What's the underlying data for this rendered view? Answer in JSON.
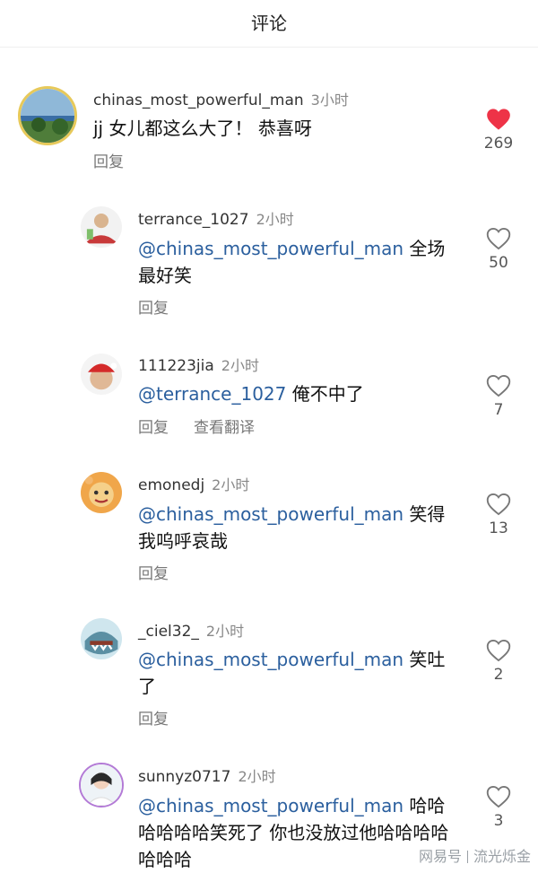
{
  "header": {
    "title": "评论"
  },
  "comments": [
    {
      "username": "chinas_most_powerful_man",
      "time": "3小时",
      "mention": "",
      "text": "jj 女儿都这么大了！ 恭喜呀",
      "reply_label": "回复",
      "translate_label": "",
      "likes": "269",
      "liked": true
    },
    {
      "username": "terrance_1027",
      "time": "2小时",
      "mention": "@chinas_most_powerful_man",
      "text": " 全场最好笑",
      "reply_label": "回复",
      "translate_label": "",
      "likes": "50",
      "liked": false
    },
    {
      "username": "111223jia",
      "time": "2小时",
      "mention": "@terrance_1027",
      "text": " 俺不中了",
      "reply_label": "回复",
      "translate_label": "查看翻译",
      "likes": "7",
      "liked": false
    },
    {
      "username": "emonedj",
      "time": "2小时",
      "mention": "@chinas_most_powerful_man",
      "text": " 笑得我呜呼哀哉",
      "reply_label": "回复",
      "translate_label": "",
      "likes": "13",
      "liked": false
    },
    {
      "username": "_ciel32_",
      "time": "2小时",
      "mention": "@chinas_most_powerful_man",
      "text": " 笑吐了",
      "reply_label": "回复",
      "translate_label": "",
      "likes": "2",
      "liked": false
    },
    {
      "username": "sunnyz0717",
      "time": "2小时",
      "mention": "@chinas_most_powerful_man",
      "text": " 哈哈哈哈哈哈笑死了 你也没放过他哈哈哈哈哈哈哈",
      "reply_label": "",
      "translate_label": "",
      "likes": "3",
      "liked": false
    }
  ],
  "watermark": {
    "left": "网易号",
    "right": "流光烁金"
  },
  "colors": {
    "liked_heart": "#ee3347",
    "mention": "#2b5f9e"
  }
}
